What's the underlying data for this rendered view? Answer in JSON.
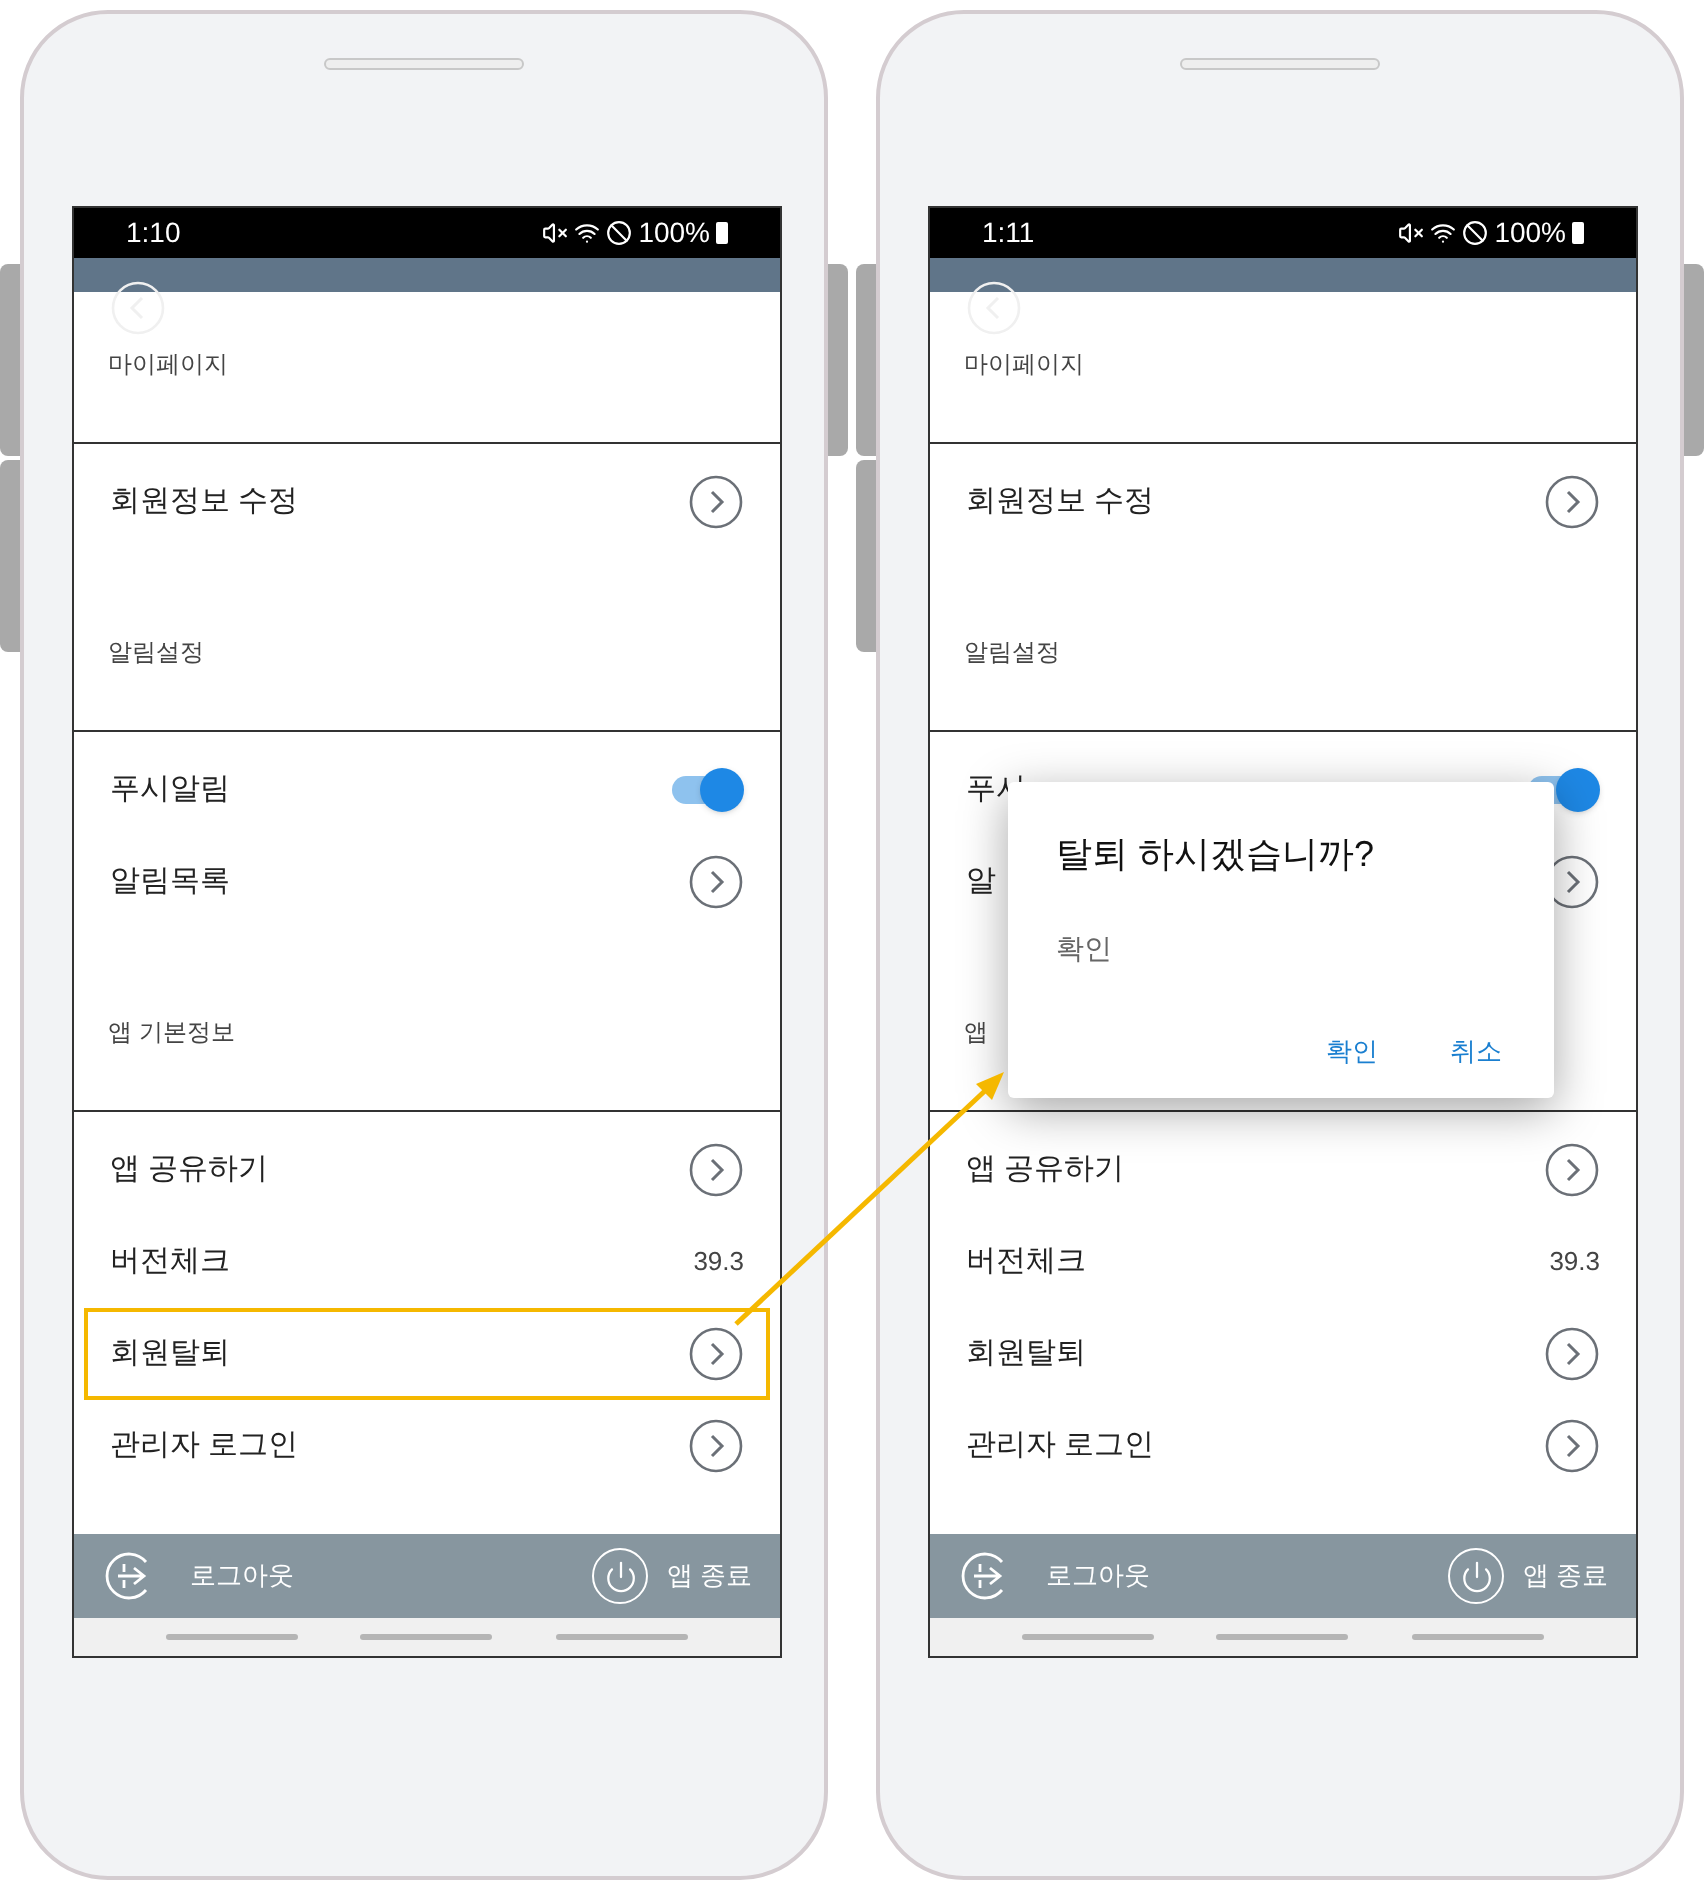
{
  "phones": [
    {
      "status_bar": {
        "time": "1:10",
        "battery": "100%"
      },
      "sections": [
        {
          "title": "마이페이지",
          "items": [
            {
              "kind": "link",
              "label": "회원정보 수정",
              "highlighted": false
            }
          ]
        },
        {
          "title": "알림설정",
          "items": [
            {
              "kind": "toggle",
              "label": "푸시알림",
              "on": true,
              "highlighted": false
            },
            {
              "kind": "link",
              "label": "알림목록",
              "highlighted": false
            }
          ]
        },
        {
          "title": "앱 기본정보",
          "items": [
            {
              "kind": "link",
              "label": "앱 공유하기",
              "highlighted": false
            },
            {
              "kind": "value",
              "label": "버전체크",
              "value": "39.3",
              "highlighted": false
            },
            {
              "kind": "link",
              "label": "회원탈퇴",
              "highlighted": true
            },
            {
              "kind": "link",
              "label": "관리자 로그인",
              "highlighted": false
            }
          ]
        }
      ],
      "bottom_bar": {
        "logout": "로그아웃",
        "exit": "앱 종료"
      }
    },
    {
      "status_bar": {
        "time": "1:11",
        "battery": "100%"
      },
      "sections": [
        {
          "title": "마이페이지",
          "items": [
            {
              "kind": "link",
              "label": "회원정보 수정",
              "highlighted": false
            }
          ]
        },
        {
          "title": "알림설정",
          "items": [
            {
              "kind": "toggle",
              "label": "푸시",
              "on": true,
              "highlighted": false
            },
            {
              "kind": "link",
              "label": "알",
              "highlighted": false
            }
          ]
        },
        {
          "title": "앱",
          "items": [
            {
              "kind": "link",
              "label": "앱 공유하기",
              "highlighted": false
            },
            {
              "kind": "value",
              "label": "버전체크",
              "value": "39.3",
              "highlighted": false
            },
            {
              "kind": "link",
              "label": "회원탈퇴",
              "highlighted": false
            },
            {
              "kind": "link",
              "label": "관리자 로그인",
              "highlighted": false
            }
          ]
        }
      ],
      "bottom_bar": {
        "logout": "로그아웃",
        "exit": "앱 종료"
      },
      "dialog": {
        "title": "탈퇴 하시겠습니까?",
        "message": "확인",
        "buttons": [
          "확인",
          "취소"
        ]
      }
    }
  ]
}
